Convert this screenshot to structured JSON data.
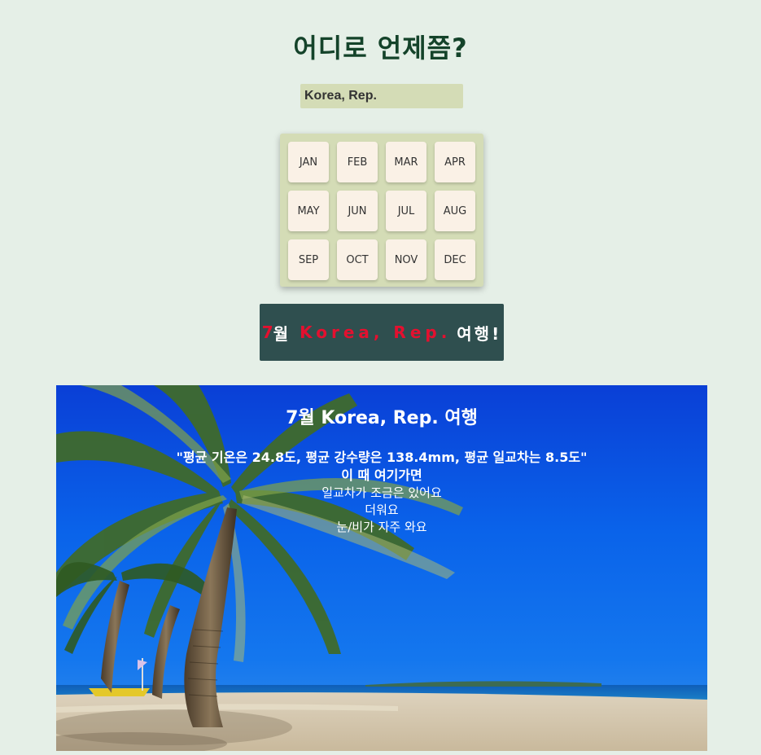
{
  "title": "어디로 언제쯤?",
  "country_input": {
    "value": "Korea, Rep."
  },
  "months": [
    "JAN",
    "FEB",
    "MAR",
    "APR",
    "MAY",
    "JUN",
    "JUL",
    "AUG",
    "SEP",
    "OCT",
    "NOV",
    "DEC"
  ],
  "result_button": {
    "month": "7",
    "month_suffix": "월",
    "country": "Korea, Rep.",
    "suffix": "여행!"
  },
  "hero": {
    "title": "7월 Korea, Rep. 여행",
    "stats": "\"평균 기온은 24.8도, 평균 강수량은 138.4mm, 평균 일교차는 8.5도\"",
    "subtitle": "이 때 여기가면",
    "lines": [
      "일교차가 조금은 있어요",
      "더워요",
      "눈/비가 자주 와요"
    ]
  },
  "colors": {
    "background": "#e5efe7",
    "title": "#14432a",
    "panel": "#d4dcb6",
    "month_button": "#faf1e6",
    "result_bg": "#2f4f4f",
    "accent_red": "#e4102f"
  }
}
